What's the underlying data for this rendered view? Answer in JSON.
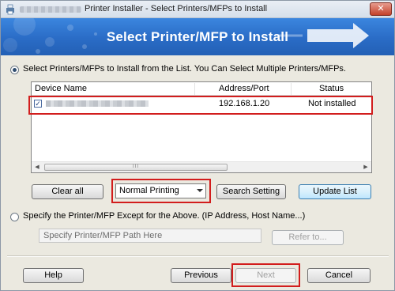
{
  "window": {
    "title": "Printer Installer - Select Printers/MFPs to Install",
    "close_label": "✕"
  },
  "banner": {
    "heading": "Select Printer/MFP to Install"
  },
  "options": {
    "select_from_list": "Select Printers/MFPs to Install from the List. You Can Select Multiple Printers/MFPs.",
    "specify_other": "Specify the Printer/MFP Except for the Above. (IP Address, Host Name...)",
    "selected": "select_from_list"
  },
  "listview": {
    "columns": [
      "Device Name",
      "Address/Port",
      "Status"
    ],
    "rows": [
      {
        "checked": true,
        "device_name": "",
        "address": "192.168.1.20",
        "status": "Not installed"
      }
    ],
    "scroll_left": "◀",
    "scroll_right": "▶",
    "scroll_grip": "III"
  },
  "toolbar": {
    "clear_all": "Clear all",
    "printing_mode": "Normal Printing",
    "search_setting": "Search Setting",
    "update_list": "Update List"
  },
  "path": {
    "placeholder": "Specify Printer/MFP Path Here",
    "refer_button": "Refer to..."
  },
  "footer": {
    "help": "Help",
    "previous": "Previous",
    "next": "Next",
    "cancel": "Cancel"
  },
  "colors": {
    "highlight_box": "#d21d1d",
    "banner": "#2a6cc6"
  }
}
